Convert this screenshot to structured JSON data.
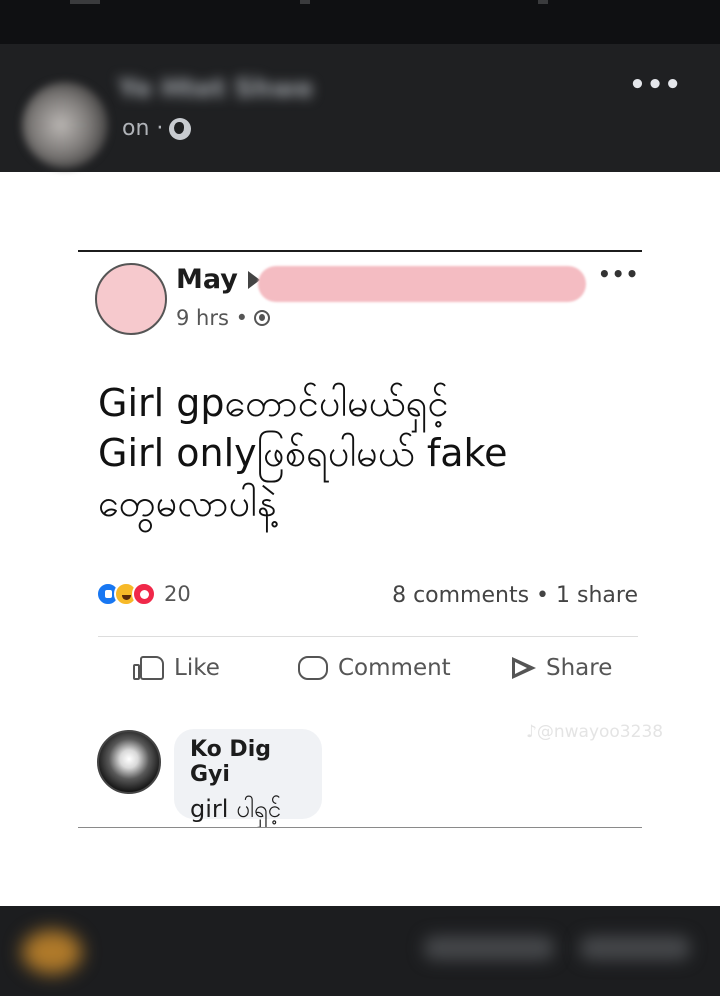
{
  "outer_post": {
    "author": "Ye Htet Shwe",
    "time_fragment": "on ·",
    "more_glyph": "•••"
  },
  "inner_post": {
    "author_name": "May",
    "time": "9 hrs •",
    "more_glyph": "•••",
    "text_lines": [
      "Girl gpတောင်ပါမယ်ရှင့်",
      "Girl onlyဖြစ်ရပါမယ် fake",
      "တွေမလာပါနဲ့"
    ],
    "reaction_count": "20",
    "engagement": "8 comments • 1 share",
    "actions": {
      "like": "Like",
      "comment": "Comment",
      "share": "Share"
    },
    "watermark": "♪@nwayoo3238"
  },
  "comment": {
    "author": "Ko Dig Gyi",
    "text": "girl ပါရှင့်"
  },
  "colors": {
    "dark_frame": "#1f2022",
    "pink_redaction": "#f4bcc2",
    "like_blue": "#1877f2",
    "haha_yellow": "#f7b928",
    "wow_red": "#f02849"
  }
}
